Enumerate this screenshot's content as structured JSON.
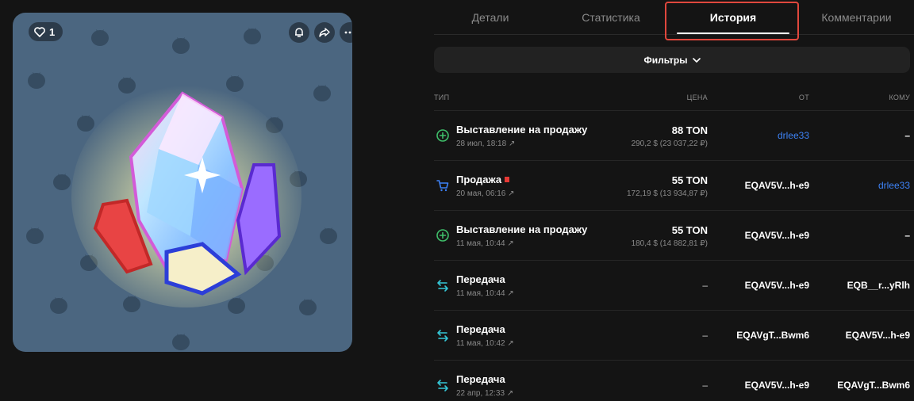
{
  "card": {
    "likes": "1",
    "background_color": "#4b6680"
  },
  "tabs": [
    {
      "label": "Детали"
    },
    {
      "label": "Статистика"
    },
    {
      "label": "История"
    },
    {
      "label": "Комментарии"
    }
  ],
  "active_tab": "История",
  "filters": {
    "label": "Фильтры"
  },
  "table": {
    "headers": {
      "type": "ТИП",
      "price": "ЦЕНА",
      "from": "ОТ",
      "to": "КОМУ"
    },
    "rows": [
      {
        "icon": "plus-circle-icon",
        "title": "Выставление на продажу",
        "date": "28 июл, 18:18 ↗",
        "price": "88 TON",
        "usd": "290,2 $ (23 037,22 ₽)",
        "from": "drlee33",
        "to": "–"
      },
      {
        "icon": "cart-icon",
        "title": "Продажа",
        "date": "20 мая, 06:16 ↗",
        "price": "55 TON",
        "usd": "172,19 $ (13 934,87 ₽)",
        "from": "EQAV5V...h-e9",
        "to": "drlee33"
      },
      {
        "icon": "plus-circle-icon",
        "title": "Выставление на продажу",
        "date": "11 мая, 10:44 ↗",
        "price": "55 TON",
        "usd": "180,4 $ (14 882,81 ₽)",
        "from": "EQAV5V...h-e9",
        "to": "–"
      },
      {
        "icon": "transfer-icon",
        "title": "Передача",
        "date": "11 мая, 10:44 ↗",
        "price": "–",
        "from": "EQAV5V...h-e9",
        "to": "EQB__r...yRlh"
      },
      {
        "icon": "transfer-icon",
        "title": "Передача",
        "date": "11 мая, 10:42 ↗",
        "price": "–",
        "from": "EQAVgT...Bwm6",
        "to": "EQAV5V...h-e9"
      },
      {
        "icon": "transfer-icon",
        "title": "Передача",
        "date": "22 апр, 12:33 ↗",
        "price": "–",
        "from": "EQAV5V...h-e9",
        "to": "EQAVgT...Bwm6"
      }
    ]
  },
  "colors": {
    "accent_link": "#3d82f6",
    "highlight_box": "#e0473d",
    "icon_green": "#3fbf6a",
    "icon_blue": "#3d82f6",
    "icon_teal": "#35c6d6"
  }
}
